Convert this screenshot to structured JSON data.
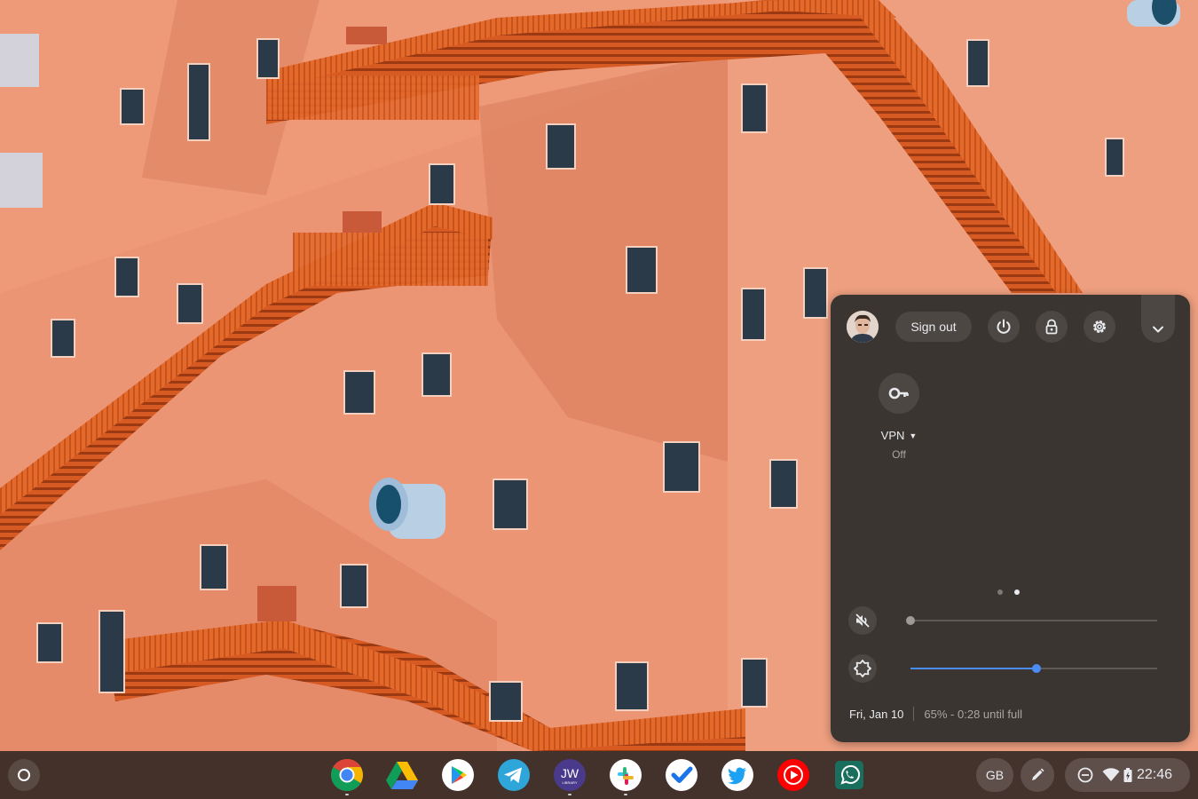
{
  "quick_settings": {
    "user": {
      "action_label": "Sign out"
    },
    "buttons": [
      "power-icon",
      "lock-icon",
      "settings-icon",
      "chevron-down-icon"
    ],
    "tiles": [
      {
        "icon": "vpn-key-icon",
        "label": "VPN",
        "status": "Off"
      }
    ],
    "page_indicator": {
      "pages": 2,
      "current": 2
    },
    "volume": {
      "icon": "volume-muted-icon",
      "level": 0
    },
    "brightness": {
      "icon": "brightness-icon",
      "level": 0.51
    },
    "footer": {
      "date": "Fri, Jan 10",
      "battery": "65% - 0:28 until full"
    }
  },
  "shelf": {
    "launcher_icon": "launcher-icon",
    "apps": [
      {
        "name": "Chrome",
        "icon": "chrome-icon",
        "running": true
      },
      {
        "name": "Google Drive",
        "icon": "drive-icon",
        "running": false
      },
      {
        "name": "Play Store",
        "icon": "play-store-icon",
        "running": false
      },
      {
        "name": "Telegram",
        "icon": "telegram-icon",
        "running": false
      },
      {
        "name": "JW Library",
        "icon": "jw-library-icon",
        "text": "JW",
        "subtext": "LIBRARY",
        "running": true
      },
      {
        "name": "Slack",
        "icon": "slack-icon",
        "running": true
      },
      {
        "name": "Tasks",
        "icon": "tasks-icon",
        "running": false
      },
      {
        "name": "Twitter",
        "icon": "twitter-icon",
        "running": false
      },
      {
        "name": "YouTube Music",
        "icon": "youtube-music-icon",
        "running": false
      },
      {
        "name": "WhatsApp",
        "icon": "whatsapp-icon",
        "running": false
      }
    ],
    "tray": {
      "ime": "GB",
      "stylus_icon": "stylus-pen-icon",
      "status_icons": [
        "do-not-disturb-icon",
        "wifi-icon",
        "battery-charging-icon"
      ],
      "time": "22:46"
    }
  },
  "colors": {
    "panel_bg": "#3b3532",
    "accent": "#4b8df8",
    "wallpaper_main": "#e8906e",
    "stairs": "#e0642a"
  }
}
